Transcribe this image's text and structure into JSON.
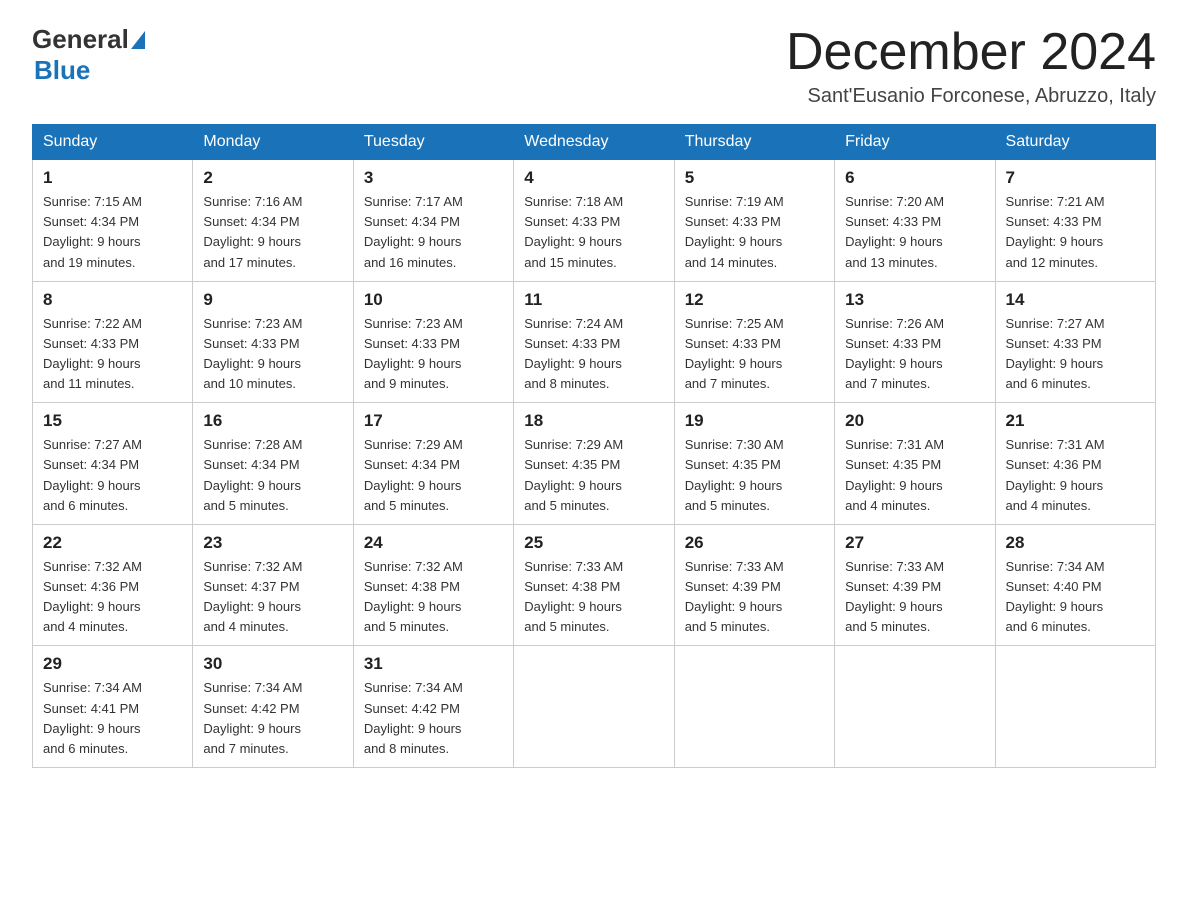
{
  "header": {
    "logo_general": "General",
    "logo_blue": "Blue",
    "month_title": "December 2024",
    "subtitle": "Sant'Eusanio Forconese, Abruzzo, Italy"
  },
  "days_of_week": [
    "Sunday",
    "Monday",
    "Tuesday",
    "Wednesday",
    "Thursday",
    "Friday",
    "Saturday"
  ],
  "weeks": [
    [
      {
        "num": "1",
        "sunrise": "7:15 AM",
        "sunset": "4:34 PM",
        "daylight": "9 hours and 19 minutes."
      },
      {
        "num": "2",
        "sunrise": "7:16 AM",
        "sunset": "4:34 PM",
        "daylight": "9 hours and 17 minutes."
      },
      {
        "num": "3",
        "sunrise": "7:17 AM",
        "sunset": "4:34 PM",
        "daylight": "9 hours and 16 minutes."
      },
      {
        "num": "4",
        "sunrise": "7:18 AM",
        "sunset": "4:33 PM",
        "daylight": "9 hours and 15 minutes."
      },
      {
        "num": "5",
        "sunrise": "7:19 AM",
        "sunset": "4:33 PM",
        "daylight": "9 hours and 14 minutes."
      },
      {
        "num": "6",
        "sunrise": "7:20 AM",
        "sunset": "4:33 PM",
        "daylight": "9 hours and 13 minutes."
      },
      {
        "num": "7",
        "sunrise": "7:21 AM",
        "sunset": "4:33 PM",
        "daylight": "9 hours and 12 minutes."
      }
    ],
    [
      {
        "num": "8",
        "sunrise": "7:22 AM",
        "sunset": "4:33 PM",
        "daylight": "9 hours and 11 minutes."
      },
      {
        "num": "9",
        "sunrise": "7:23 AM",
        "sunset": "4:33 PM",
        "daylight": "9 hours and 10 minutes."
      },
      {
        "num": "10",
        "sunrise": "7:23 AM",
        "sunset": "4:33 PM",
        "daylight": "9 hours and 9 minutes."
      },
      {
        "num": "11",
        "sunrise": "7:24 AM",
        "sunset": "4:33 PM",
        "daylight": "9 hours and 8 minutes."
      },
      {
        "num": "12",
        "sunrise": "7:25 AM",
        "sunset": "4:33 PM",
        "daylight": "9 hours and 7 minutes."
      },
      {
        "num": "13",
        "sunrise": "7:26 AM",
        "sunset": "4:33 PM",
        "daylight": "9 hours and 7 minutes."
      },
      {
        "num": "14",
        "sunrise": "7:27 AM",
        "sunset": "4:33 PM",
        "daylight": "9 hours and 6 minutes."
      }
    ],
    [
      {
        "num": "15",
        "sunrise": "7:27 AM",
        "sunset": "4:34 PM",
        "daylight": "9 hours and 6 minutes."
      },
      {
        "num": "16",
        "sunrise": "7:28 AM",
        "sunset": "4:34 PM",
        "daylight": "9 hours and 5 minutes."
      },
      {
        "num": "17",
        "sunrise": "7:29 AM",
        "sunset": "4:34 PM",
        "daylight": "9 hours and 5 minutes."
      },
      {
        "num": "18",
        "sunrise": "7:29 AM",
        "sunset": "4:35 PM",
        "daylight": "9 hours and 5 minutes."
      },
      {
        "num": "19",
        "sunrise": "7:30 AM",
        "sunset": "4:35 PM",
        "daylight": "9 hours and 5 minutes."
      },
      {
        "num": "20",
        "sunrise": "7:31 AM",
        "sunset": "4:35 PM",
        "daylight": "9 hours and 4 minutes."
      },
      {
        "num": "21",
        "sunrise": "7:31 AM",
        "sunset": "4:36 PM",
        "daylight": "9 hours and 4 minutes."
      }
    ],
    [
      {
        "num": "22",
        "sunrise": "7:32 AM",
        "sunset": "4:36 PM",
        "daylight": "9 hours and 4 minutes."
      },
      {
        "num": "23",
        "sunrise": "7:32 AM",
        "sunset": "4:37 PM",
        "daylight": "9 hours and 4 minutes."
      },
      {
        "num": "24",
        "sunrise": "7:32 AM",
        "sunset": "4:38 PM",
        "daylight": "9 hours and 5 minutes."
      },
      {
        "num": "25",
        "sunrise": "7:33 AM",
        "sunset": "4:38 PM",
        "daylight": "9 hours and 5 minutes."
      },
      {
        "num": "26",
        "sunrise": "7:33 AM",
        "sunset": "4:39 PM",
        "daylight": "9 hours and 5 minutes."
      },
      {
        "num": "27",
        "sunrise": "7:33 AM",
        "sunset": "4:39 PM",
        "daylight": "9 hours and 5 minutes."
      },
      {
        "num": "28",
        "sunrise": "7:34 AM",
        "sunset": "4:40 PM",
        "daylight": "9 hours and 6 minutes."
      }
    ],
    [
      {
        "num": "29",
        "sunrise": "7:34 AM",
        "sunset": "4:41 PM",
        "daylight": "9 hours and 6 minutes."
      },
      {
        "num": "30",
        "sunrise": "7:34 AM",
        "sunset": "4:42 PM",
        "daylight": "9 hours and 7 minutes."
      },
      {
        "num": "31",
        "sunrise": "7:34 AM",
        "sunset": "4:42 PM",
        "daylight": "9 hours and 8 minutes."
      },
      null,
      null,
      null,
      null
    ]
  ],
  "labels": {
    "sunrise": "Sunrise:",
    "sunset": "Sunset:",
    "daylight": "Daylight:"
  }
}
